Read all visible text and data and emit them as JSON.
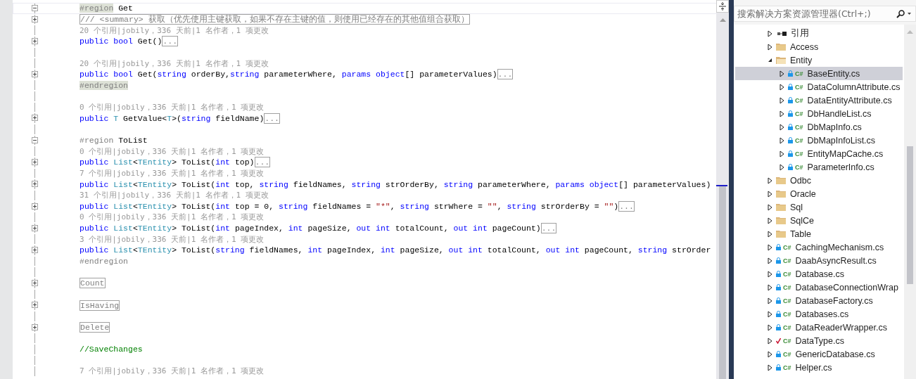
{
  "editor": {
    "lines": [
      {
        "expanded": true,
        "current": true,
        "tokens": [
          {
            "kind": "dirmatch",
            "text": "#region"
          },
          {
            "kind": "plain",
            "text": " Get"
          }
        ]
      },
      {
        "expanded": false,
        "current": false,
        "tokens": [
          {
            "kind": "summary",
            "text": "/// <summary> 获取（优先使用主键获取，如果不存在主键的值，则使用已经存在的其他值组合获取）"
          }
        ]
      },
      {
        "current": false,
        "tokens": [
          {
            "kind": "lens",
            "text": "20 个引用|jobily，336 天前|1 名作者，1 项更改"
          }
        ]
      },
      {
        "expanded": false,
        "current": false,
        "tokens": [
          {
            "kind": "kw",
            "text": "public "
          },
          {
            "kind": "kw",
            "text": "bool"
          },
          {
            "kind": "plain",
            "text": " Get()"
          },
          {
            "kind": "folded",
            "text": "..."
          }
        ]
      },
      {
        "current": false
      },
      {
        "current": false,
        "tokens": [
          {
            "kind": "lens",
            "text": "20 个引用|jobily，336 天前|1 名作者，1 项更改"
          }
        ]
      },
      {
        "expanded": false,
        "current": false,
        "tokens": [
          {
            "kind": "kw",
            "text": "public "
          },
          {
            "kind": "kw",
            "text": "bool"
          },
          {
            "kind": "plain",
            "text": " Get("
          },
          {
            "kind": "kw",
            "text": "string"
          },
          {
            "kind": "plain",
            "text": " orderBy,"
          },
          {
            "kind": "kw",
            "text": "string"
          },
          {
            "kind": "plain",
            "text": " parameterWhere, "
          },
          {
            "kind": "kw",
            "text": "params "
          },
          {
            "kind": "kw",
            "text": "object"
          },
          {
            "kind": "plain",
            "text": "[] parameterValues)"
          },
          {
            "kind": "folded",
            "text": "..."
          }
        ]
      },
      {
        "current": false,
        "tokens": [
          {
            "kind": "dirmatch",
            "text": "#endregion"
          }
        ]
      },
      {
        "current": false
      },
      {
        "current": false,
        "tokens": [
          {
            "kind": "lens",
            "text": "0 个引用|jobily，336 天前|1 名作者，1 项更改"
          }
        ]
      },
      {
        "expanded": false,
        "current": false,
        "tokens": [
          {
            "kind": "kw",
            "text": "public "
          },
          {
            "kind": "type",
            "text": "T"
          },
          {
            "kind": "plain",
            "text": " GetValue<"
          },
          {
            "kind": "type",
            "text": "T"
          },
          {
            "kind": "plain",
            "text": ">("
          },
          {
            "kind": "kw",
            "text": "string"
          },
          {
            "kind": "plain",
            "text": " fieldName)"
          },
          {
            "kind": "folded",
            "text": "..."
          }
        ]
      },
      {
        "current": false
      },
      {
        "expanded": true,
        "current": false,
        "tokens": [
          {
            "kind": "dir",
            "text": "#region"
          },
          {
            "kind": "plain",
            "text": " ToList"
          }
        ]
      },
      {
        "current": false,
        "tokens": [
          {
            "kind": "lens",
            "text": "0 个引用|jobily，336 天前|1 名作者，1 项更改"
          }
        ]
      },
      {
        "expanded": false,
        "current": false,
        "tokens": [
          {
            "kind": "kw",
            "text": "public "
          },
          {
            "kind": "type",
            "text": "List"
          },
          {
            "kind": "plain",
            "text": "<"
          },
          {
            "kind": "type",
            "text": "TEntity"
          },
          {
            "kind": "plain",
            "text": "> ToList("
          },
          {
            "kind": "kw",
            "text": "int"
          },
          {
            "kind": "plain",
            "text": " top)"
          },
          {
            "kind": "folded",
            "text": "..."
          }
        ]
      },
      {
        "current": false,
        "tokens": [
          {
            "kind": "lens",
            "text": "7 个引用|jobily，336 天前|1 名作者，1 项更改"
          }
        ]
      },
      {
        "expanded": false,
        "current": false,
        "tokens": [
          {
            "kind": "kw",
            "text": "public "
          },
          {
            "kind": "type",
            "text": "List"
          },
          {
            "kind": "plain",
            "text": "<"
          },
          {
            "kind": "type",
            "text": "TEntity"
          },
          {
            "kind": "plain",
            "text": "> ToList("
          },
          {
            "kind": "kw",
            "text": "int"
          },
          {
            "kind": "plain",
            "text": " top, "
          },
          {
            "kind": "kw",
            "text": "string"
          },
          {
            "kind": "plain",
            "text": " fieldNames, "
          },
          {
            "kind": "kw",
            "text": "string"
          },
          {
            "kind": "plain",
            "text": " strOrderBy, "
          },
          {
            "kind": "kw",
            "text": "string"
          },
          {
            "kind": "plain",
            "text": " parameterWhere, "
          },
          {
            "kind": "kw",
            "text": "params "
          },
          {
            "kind": "kw",
            "text": "object"
          },
          {
            "kind": "plain",
            "text": "[] parameterValues)"
          }
        ]
      },
      {
        "current": false,
        "tokens": [
          {
            "kind": "lens",
            "text": "31 个引用|jobily，336 天前|1 名作者，1 项更改"
          }
        ]
      },
      {
        "expanded": false,
        "current": false,
        "tokens": [
          {
            "kind": "kw",
            "text": "public "
          },
          {
            "kind": "type",
            "text": "List"
          },
          {
            "kind": "plain",
            "text": "<"
          },
          {
            "kind": "type",
            "text": "TEntity"
          },
          {
            "kind": "plain",
            "text": "> ToList("
          },
          {
            "kind": "kw",
            "text": "int"
          },
          {
            "kind": "plain",
            "text": " top = 0, "
          },
          {
            "kind": "kw",
            "text": "string"
          },
          {
            "kind": "plain",
            "text": " fieldNames = "
          },
          {
            "kind": "str",
            "text": "\"*\""
          },
          {
            "kind": "plain",
            "text": ", "
          },
          {
            "kind": "kw",
            "text": "string"
          },
          {
            "kind": "plain",
            "text": " strWhere = "
          },
          {
            "kind": "str",
            "text": "\"\""
          },
          {
            "kind": "plain",
            "text": ", "
          },
          {
            "kind": "kw",
            "text": "string"
          },
          {
            "kind": "plain",
            "text": " strOrderBy = "
          },
          {
            "kind": "str",
            "text": "\"\""
          },
          {
            "kind": "plain",
            "text": ")"
          },
          {
            "kind": "folded",
            "text": "..."
          }
        ]
      },
      {
        "current": false,
        "tokens": [
          {
            "kind": "lens",
            "text": "0 个引用|jobily，336 天前|1 名作者，1 项更改"
          }
        ]
      },
      {
        "expanded": false,
        "current": false,
        "tokens": [
          {
            "kind": "kw",
            "text": "public "
          },
          {
            "kind": "type",
            "text": "List"
          },
          {
            "kind": "plain",
            "text": "<"
          },
          {
            "kind": "type",
            "text": "TEntity"
          },
          {
            "kind": "plain",
            "text": "> ToList("
          },
          {
            "kind": "kw",
            "text": "int"
          },
          {
            "kind": "plain",
            "text": " pageIndex, "
          },
          {
            "kind": "kw",
            "text": "int"
          },
          {
            "kind": "plain",
            "text": " pageSize, "
          },
          {
            "kind": "kw",
            "text": "out int"
          },
          {
            "kind": "plain",
            "text": " totalCount, "
          },
          {
            "kind": "kw",
            "text": "out int"
          },
          {
            "kind": "plain",
            "text": " pageCount)"
          },
          {
            "kind": "folded",
            "text": "..."
          }
        ]
      },
      {
        "current": false,
        "tokens": [
          {
            "kind": "lens",
            "text": "3 个引用|jobily，336 天前|1 名作者，1 项更改"
          }
        ]
      },
      {
        "expanded": false,
        "current": false,
        "tokens": [
          {
            "kind": "kw",
            "text": "public "
          },
          {
            "kind": "type",
            "text": "List"
          },
          {
            "kind": "plain",
            "text": "<"
          },
          {
            "kind": "type",
            "text": "TEntity"
          },
          {
            "kind": "plain",
            "text": "> ToList("
          },
          {
            "kind": "kw",
            "text": "string"
          },
          {
            "kind": "plain",
            "text": " fieldNames, "
          },
          {
            "kind": "kw",
            "text": "int"
          },
          {
            "kind": "plain",
            "text": " pageIndex, "
          },
          {
            "kind": "kw",
            "text": "int"
          },
          {
            "kind": "plain",
            "text": " pageSize, "
          },
          {
            "kind": "kw",
            "text": "out int"
          },
          {
            "kind": "plain",
            "text": " totalCount, "
          },
          {
            "kind": "kw",
            "text": "out int"
          },
          {
            "kind": "plain",
            "text": " pageCount, "
          },
          {
            "kind": "kw",
            "text": "string"
          },
          {
            "kind": "plain",
            "text": " strOrder"
          }
        ]
      },
      {
        "current": false,
        "tokens": [
          {
            "kind": "dir",
            "text": "#endregion"
          }
        ]
      },
      {
        "current": false
      },
      {
        "expanded": false,
        "current": false,
        "tokens": [
          {
            "kind": "folded",
            "text": "Count"
          }
        ]
      },
      {
        "current": false
      },
      {
        "expanded": false,
        "current": false,
        "tokens": [
          {
            "kind": "folded",
            "text": "IsHaving"
          }
        ]
      },
      {
        "current": false
      },
      {
        "expanded": false,
        "current": false,
        "tokens": [
          {
            "kind": "folded",
            "text": "Delete"
          }
        ]
      },
      {
        "current": false
      },
      {
        "current": false,
        "tokens": [
          {
            "kind": "comment",
            "text": "//SaveChanges"
          }
        ]
      },
      {
        "current": false
      },
      {
        "current": false,
        "tokens": [
          {
            "kind": "lens",
            "text": "7 个引用|jobily，336 天前|1 名作者，1 项更改"
          }
        ]
      }
    ]
  },
  "solution_explorer": {
    "search": {
      "placeholder": "搜索解决方案资源管理器(Ctrl+;)"
    },
    "items": [
      {
        "kind": "references",
        "label": "引用",
        "expanded": false,
        "selected": false
      },
      {
        "kind": "folder",
        "label": "Access",
        "expanded": false,
        "selected": false
      },
      {
        "kind": "folder",
        "label": "Entity",
        "expanded": true,
        "selected": false,
        "children": [
          {
            "kind": "file",
            "label": "BaseEntity.cs",
            "badge": "C#",
            "modified": false,
            "expanded": false,
            "selected": true
          },
          {
            "kind": "file",
            "label": "DataColumnAttribute.cs",
            "badge": "C#",
            "modified": false,
            "expanded": false,
            "selected": false
          },
          {
            "kind": "file",
            "label": "DataEntityAttribute.cs",
            "badge": "C#",
            "modified": false,
            "expanded": false,
            "selected": false
          },
          {
            "kind": "file",
            "label": "DbHandleList.cs",
            "badge": "C#",
            "modified": false,
            "expanded": false,
            "selected": false
          },
          {
            "kind": "file",
            "label": "DbMapInfo.cs",
            "badge": "C#",
            "modified": false,
            "expanded": false,
            "selected": false
          },
          {
            "kind": "file",
            "label": "DbMapInfoList.cs",
            "badge": "C#",
            "modified": false,
            "expanded": false,
            "selected": false
          },
          {
            "kind": "file",
            "label": "EntityMapCache.cs",
            "badge": "C#",
            "modified": false,
            "expanded": false,
            "selected": false
          },
          {
            "kind": "file",
            "label": "ParameterInfo.cs",
            "badge": "C#",
            "modified": false,
            "expanded": false,
            "selected": false
          }
        ]
      },
      {
        "kind": "folder",
        "label": "Odbc",
        "expanded": false,
        "selected": false
      },
      {
        "kind": "folder",
        "label": "Oracle",
        "expanded": false,
        "selected": false
      },
      {
        "kind": "folder",
        "label": "Sql",
        "expanded": false,
        "selected": false
      },
      {
        "kind": "folder",
        "label": "SqlCe",
        "expanded": false,
        "selected": false
      },
      {
        "kind": "folder",
        "label": "Table",
        "expanded": false,
        "selected": false
      },
      {
        "kind": "file",
        "label": "CachingMechanism.cs",
        "badge": "C#",
        "modified": false,
        "expanded": false,
        "selected": false
      },
      {
        "kind": "file",
        "label": "DaabAsyncResult.cs",
        "badge": "C#",
        "modified": false,
        "expanded": false,
        "selected": false
      },
      {
        "kind": "file",
        "label": "Database.cs",
        "badge": "C#",
        "modified": false,
        "expanded": false,
        "selected": false
      },
      {
        "kind": "file",
        "label": "DatabaseConnectionWrap",
        "badge": "C#",
        "modified": false,
        "expanded": false,
        "selected": false
      },
      {
        "kind": "file",
        "label": "DatabaseFactory.cs",
        "badge": "C#",
        "modified": false,
        "expanded": false,
        "selected": false
      },
      {
        "kind": "file",
        "label": "Databases.cs",
        "badge": "C#",
        "modified": false,
        "expanded": false,
        "selected": false
      },
      {
        "kind": "file",
        "label": "DataReaderWrapper.cs",
        "badge": "C#",
        "modified": false,
        "expanded": false,
        "selected": false
      },
      {
        "kind": "file",
        "label": "DataType.cs",
        "badge": "C#",
        "modified": true,
        "expanded": false,
        "selected": false
      },
      {
        "kind": "file",
        "label": "GenericDatabase.cs",
        "badge": "C#",
        "modified": false,
        "expanded": false,
        "selected": false
      },
      {
        "kind": "file",
        "label": "Helper.cs",
        "badge": "C#",
        "modified": false,
        "expanded": false,
        "selected": false
      }
    ]
  }
}
